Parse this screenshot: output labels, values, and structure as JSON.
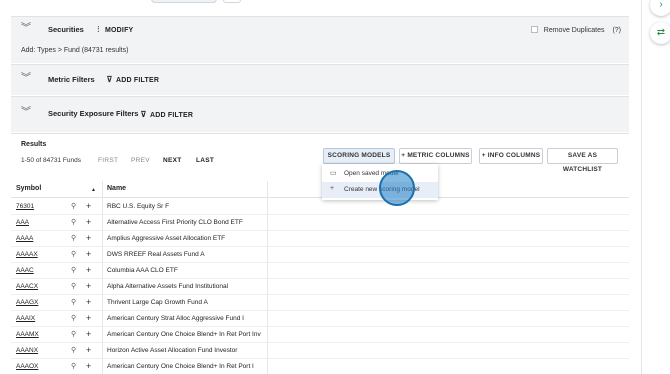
{
  "panels": {
    "securities": {
      "title": "Securities",
      "action": "MODIFY",
      "subtext": "Add: Types > Fund (84731 results)",
      "remove_duplicates": "Remove Duplicates",
      "help": "(?)"
    },
    "metric": {
      "title": "Metric Filters",
      "action": "ADD FILTER"
    },
    "exposure": {
      "title": "Security Exposure Filters",
      "action": "ADD FILTER"
    }
  },
  "results": {
    "title": "Results",
    "count": "1-50 of 84731 Funds",
    "pager": {
      "first": "FIRST",
      "prev": "PREV",
      "next": "NEXT",
      "last": "LAST"
    },
    "buttons": {
      "scoring": "SCORING MODELS",
      "metric_columns": "METRIC COLUMNS",
      "info_columns": "INFO COLUMNS",
      "watchlist": "SAVE AS WATCHLIST"
    },
    "dropdown": [
      {
        "icon": "open-folder-icon",
        "label": "Open saved model"
      },
      {
        "icon": "plus-icon",
        "label": "Create new scoring model"
      }
    ],
    "columns": {
      "symbol": "Symbol",
      "name": "Name"
    },
    "rows": [
      {
        "symbol": "76301",
        "name": "RBC U.S. Equity Sr F"
      },
      {
        "symbol": "AAA",
        "name": "Alternative Access First Priority CLO Bond ETF"
      },
      {
        "symbol": "AAAA",
        "name": "Amplius Aggressive Asset Allocation ETF"
      },
      {
        "symbol": "AAAAX",
        "name": "DWS RREEF Real Assets Fund A"
      },
      {
        "symbol": "AAAC",
        "name": "Columbia AAA CLO ETF"
      },
      {
        "symbol": "AAACX",
        "name": "Alpha Alternative Assets Fund Institutional"
      },
      {
        "symbol": "AAAGX",
        "name": "Thrivent Large Cap Growth Fund A"
      },
      {
        "symbol": "AAAIX",
        "name": "American Century Strat Alloc Aggressive Fund I"
      },
      {
        "symbol": "AAAMX",
        "name": "American Century One Choice Blend+ In Ret Port Inv"
      },
      {
        "symbol": "AAANX",
        "name": "Horizon Active Asset Allocation Fund Investor"
      },
      {
        "symbol": "AAAOX",
        "name": "American Century One Choice Blend+ In Ret Port I"
      }
    ]
  }
}
